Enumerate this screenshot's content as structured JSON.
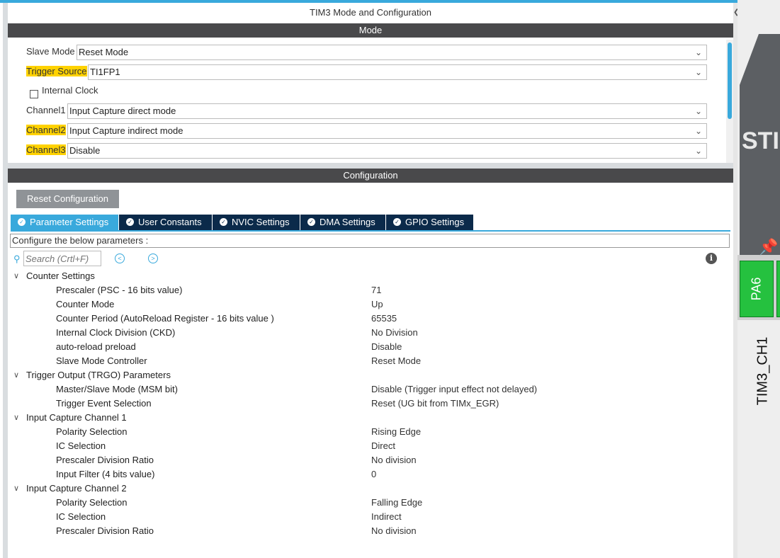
{
  "window": {
    "title": "TIM3 Mode and Configuration"
  },
  "mode": {
    "header": "Mode",
    "slave_mode_label": "Slave Mode",
    "slave_mode_value": "Reset Mode",
    "trigger_source_label": "Trigger Source",
    "trigger_source_value": "TI1FP1",
    "internal_clock_label": "Internal Clock",
    "internal_clock_checked": false,
    "channel1_label": "Channel1",
    "channel1_value": "Input Capture direct mode",
    "channel2_label": "Channel2",
    "channel2_value": "Input Capture indirect mode",
    "channel3_label": "Channel3",
    "channel3_value": "Disable"
  },
  "configuration": {
    "header": "Configuration",
    "reset_label": "Reset Configuration",
    "tabs": [
      {
        "label": "Parameter Settings",
        "active": true
      },
      {
        "label": "User Constants",
        "active": false
      },
      {
        "label": "NVIC Settings",
        "active": false
      },
      {
        "label": "DMA Settings",
        "active": false
      },
      {
        "label": "GPIO Settings",
        "active": false
      }
    ],
    "configure_text": "Configure the below parameters :",
    "search_placeholder": "Search (Crtl+F)",
    "groups": [
      {
        "name": "Counter Settings",
        "params": [
          {
            "name": "Prescaler (PSC - 16 bits value)",
            "value": "71"
          },
          {
            "name": "Counter Mode",
            "value": "Up"
          },
          {
            "name": "Counter Period (AutoReload Register - 16 bits value )",
            "value": "65535"
          },
          {
            "name": "Internal Clock Division (CKD)",
            "value": "No Division"
          },
          {
            "name": "auto-reload preload",
            "value": "Disable"
          },
          {
            "name": "Slave Mode Controller",
            "value": "Reset Mode"
          }
        ]
      },
      {
        "name": "Trigger Output (TRGO) Parameters",
        "params": [
          {
            "name": "Master/Slave Mode (MSM bit)",
            "value": "Disable (Trigger input effect not delayed)"
          },
          {
            "name": "Trigger Event Selection",
            "value": "Reset (UG bit from TIMx_EGR)"
          }
        ]
      },
      {
        "name": "Input Capture Channel 1",
        "params": [
          {
            "name": "Polarity Selection",
            "value": "Rising Edge"
          },
          {
            "name": "IC Selection",
            "value": "Direct"
          },
          {
            "name": "Prescaler Division Ratio",
            "value": "No division"
          },
          {
            "name": "Input Filter (4 bits value)",
            "value": "0"
          }
        ]
      },
      {
        "name": "Input Capture Channel 2",
        "params": [
          {
            "name": "Polarity Selection",
            "value": "Falling Edge"
          },
          {
            "name": "IC Selection",
            "value": "Indirect"
          },
          {
            "name": "Prescaler Division Ratio",
            "value": "No division"
          }
        ]
      }
    ]
  },
  "chip_view": {
    "chip_text": "STI",
    "pin_name": "PA6",
    "pin_signal": "TIM3_CH1"
  },
  "colors": {
    "accent": "#39a9dc",
    "section_bar": "#49494b",
    "tab_bg": "#0b2a4a",
    "highlight": "#ffd200",
    "pin_green": "#25c13f"
  }
}
